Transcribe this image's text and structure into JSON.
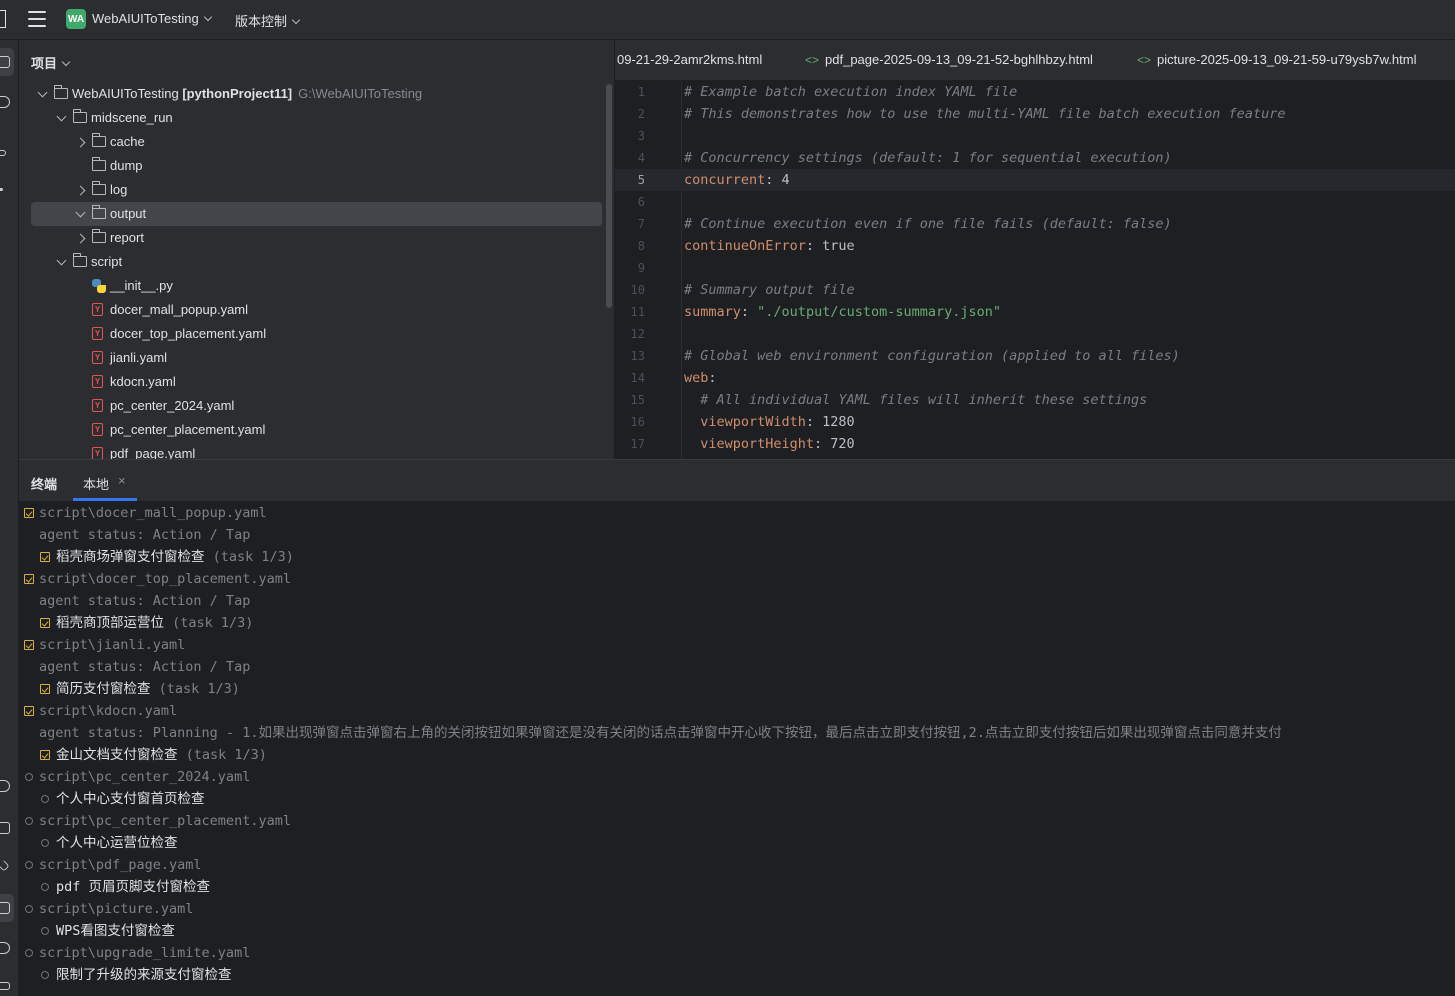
{
  "titlebar": {
    "project_badge": "WA",
    "project_name": "WebAIUIToTesting",
    "vcs_label": "版本控制"
  },
  "project_panel": {
    "header": "项目",
    "tree": [
      {
        "label": "WebAIUIToTesting",
        "extra": "[pythonProject11]",
        "path": "G:\\WebAIUIToTesting",
        "type": "folder",
        "indent": 0,
        "expanded": true
      },
      {
        "label": "midscene_run",
        "type": "folder",
        "indent": 1,
        "expanded": true
      },
      {
        "label": "cache",
        "type": "folder",
        "indent": 2,
        "expanded": false
      },
      {
        "label": "dump",
        "type": "folder",
        "indent": 2,
        "expanded": null
      },
      {
        "label": "log",
        "type": "folder",
        "indent": 2,
        "expanded": false
      },
      {
        "label": "output",
        "type": "folder",
        "indent": 2,
        "expanded": true,
        "selected": true
      },
      {
        "label": "report",
        "type": "folder",
        "indent": 2,
        "expanded": false
      },
      {
        "label": "script",
        "type": "folder",
        "indent": 1,
        "expanded": true
      },
      {
        "label": "__init__.py",
        "type": "python",
        "indent": 2
      },
      {
        "label": "docer_mall_popup.yaml",
        "type": "yaml",
        "indent": 2
      },
      {
        "label": "docer_top_placement.yaml",
        "type": "yaml",
        "indent": 2
      },
      {
        "label": "jianli.yaml",
        "type": "yaml",
        "indent": 2
      },
      {
        "label": "kdocn.yaml",
        "type": "yaml",
        "indent": 2
      },
      {
        "label": "pc_center_2024.yaml",
        "type": "yaml",
        "indent": 2
      },
      {
        "label": "pc_center_placement.yaml",
        "type": "yaml",
        "indent": 2
      },
      {
        "label": "pdf_page.yaml",
        "type": "yaml",
        "indent": 2
      }
    ]
  },
  "editor": {
    "tabs": [
      {
        "label": "09-21-29-2amr2kms.html",
        "icon": false
      },
      {
        "label": "pdf_page-2025-09-13_09-21-52-bghlhbzy.html",
        "icon": true
      },
      {
        "label": "picture-2025-09-13_09-21-59-u79ysb7w.html",
        "icon": true
      }
    ],
    "current_line": 5,
    "lines": [
      {
        "n": "1",
        "parts": [
          {
            "t": "# Example batch execution index YAML file",
            "c": "cm"
          }
        ]
      },
      {
        "n": "2",
        "parts": [
          {
            "t": "# This demonstrates how to use the multi-YAML file batch execution feature",
            "c": "cm"
          }
        ]
      },
      {
        "n": "3",
        "parts": []
      },
      {
        "n": "4",
        "parts": [
          {
            "t": "# Concurrency settings (default: 1 for sequential execution)",
            "c": "cm"
          }
        ]
      },
      {
        "n": "5",
        "parts": [
          {
            "t": "concurrent",
            "c": "ky"
          },
          {
            "t": ": 4",
            "c": "vl"
          }
        ]
      },
      {
        "n": "6",
        "parts": []
      },
      {
        "n": "7",
        "parts": [
          {
            "t": "# Continue execution even if one file fails (default: false)",
            "c": "cm"
          }
        ]
      },
      {
        "n": "8",
        "parts": [
          {
            "t": "continueOnError",
            "c": "ky"
          },
          {
            "t": ": true",
            "c": "vl"
          }
        ]
      },
      {
        "n": "9",
        "parts": []
      },
      {
        "n": "10",
        "parts": [
          {
            "t": "# Summary output file",
            "c": "cm"
          }
        ]
      },
      {
        "n": "11",
        "parts": [
          {
            "t": "summary",
            "c": "ky"
          },
          {
            "t": ": ",
            "c": "vl"
          },
          {
            "t": "\"./output/custom-summary.json\"",
            "c": "st"
          }
        ]
      },
      {
        "n": "12",
        "parts": []
      },
      {
        "n": "13",
        "parts": [
          {
            "t": "# Global web environment configuration (applied to all files)",
            "c": "cm"
          }
        ]
      },
      {
        "n": "14",
        "parts": [
          {
            "t": "web",
            "c": "ky"
          },
          {
            "t": ":",
            "c": "vl"
          }
        ]
      },
      {
        "n": "15",
        "parts": [
          {
            "t": "  # All individual YAML files will inherit these settings",
            "c": "cm"
          }
        ]
      },
      {
        "n": "16",
        "parts": [
          {
            "t": "  viewportWidth",
            "c": "ky"
          },
          {
            "t": ": 1280",
            "c": "vl"
          }
        ]
      },
      {
        "n": "17",
        "parts": [
          {
            "t": "  viewportHeight",
            "c": "ky"
          },
          {
            "t": ": 720",
            "c": "vl"
          }
        ]
      }
    ]
  },
  "terminal": {
    "title": "终端",
    "tab_label": "本地",
    "close_glyph": "×",
    "lines": [
      {
        "icon": "check",
        "indent": 0,
        "text": "script\\docer_mall_popup.yaml"
      },
      {
        "icon": "none",
        "indent": 1,
        "text": "agent status: Action / Tap"
      },
      {
        "icon": "check",
        "indent": 1,
        "text": "稻壳商场弹窗支付窗检查",
        "suffix": " (task 1/3)"
      },
      {
        "icon": "check",
        "indent": 0,
        "text": "script\\docer_top_placement.yaml"
      },
      {
        "icon": "none",
        "indent": 1,
        "text": "agent status: Action / Tap"
      },
      {
        "icon": "check",
        "indent": 1,
        "text": "稻壳商顶部运营位",
        "suffix": " (task 1/3)"
      },
      {
        "icon": "check",
        "indent": 0,
        "text": "script\\jianli.yaml"
      },
      {
        "icon": "none",
        "indent": 1,
        "text": "agent status: Action / Tap"
      },
      {
        "icon": "check",
        "indent": 1,
        "text": "简历支付窗检查",
        "suffix": " (task 1/3)"
      },
      {
        "icon": "check",
        "indent": 0,
        "text": "script\\kdocn.yaml"
      },
      {
        "icon": "none",
        "indent": 1,
        "text": "agent status: Planning - 1.如果出现弹窗点击弹窗右上角的关闭按钮如果弹窗还是没有关闭的话点击弹窗中开心收下按钮，最后点击立即支付按钮,2.点击立即支付按钮后如果出现弹窗点击同意并支付"
      },
      {
        "icon": "check",
        "indent": 1,
        "text": "金山文档支付窗检查",
        "suffix": " (task 1/3)"
      },
      {
        "icon": "pending",
        "indent": 0,
        "text": "script\\pc_center_2024.yaml"
      },
      {
        "icon": "pending",
        "indent": 1,
        "text": "个人中心支付窗首页检查"
      },
      {
        "icon": "pending",
        "indent": 0,
        "text": "script\\pc_center_placement.yaml"
      },
      {
        "icon": "pending",
        "indent": 1,
        "text": "个人中心运营位检查"
      },
      {
        "icon": "pending",
        "indent": 0,
        "text": "script\\pdf_page.yaml"
      },
      {
        "icon": "pending",
        "indent": 1,
        "text": "pdf 页眉页脚支付窗检查"
      },
      {
        "icon": "pending",
        "indent": 0,
        "text": "script\\picture.yaml"
      },
      {
        "icon": "pending",
        "indent": 1,
        "text": "WPS看图支付窗检查"
      },
      {
        "icon": "pending",
        "indent": 0,
        "text": "script\\upgrade_limite.yaml"
      },
      {
        "icon": "pending",
        "indent": 1,
        "text": "限制了升级的来源支付窗检查"
      }
    ]
  }
}
